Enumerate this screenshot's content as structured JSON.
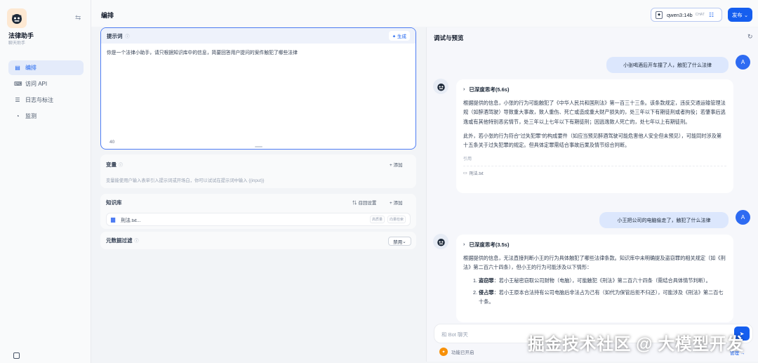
{
  "app": {
    "name": "法律助手",
    "type": "聊天助手"
  },
  "nav": {
    "items": [
      {
        "icon": "layout-icon",
        "label": "编排"
      },
      {
        "icon": "api-icon",
        "label": "访问 API"
      },
      {
        "icon": "log-icon",
        "label": "日志与标注"
      },
      {
        "icon": "monitor-icon",
        "label": "监测"
      }
    ]
  },
  "topbar": {
    "title": "编排",
    "model": "qwen3:14b",
    "model_mode": "CHAT",
    "publish": "发布"
  },
  "prompt": {
    "title": "提示词",
    "generate": "生成",
    "text": "你是一个法律小助手，请只根据知识库中的信息，简要回答用户提问的案件触犯了哪些法律",
    "count": "40"
  },
  "variables": {
    "title": "变量",
    "add": "添加",
    "desc": "变量能使用户输入表单引入提示词或开场白，你可以试试在提示词中输入 {{input}}"
  },
  "knowledge": {
    "title": "知识库",
    "recall": "召回设置",
    "add": "添加",
    "item": "刑法.txt...",
    "tags": [
      "高质量",
      "向量检索"
    ]
  },
  "metadata": {
    "title": "元数据过滤",
    "select": "禁用"
  },
  "preview": {
    "title": "调试与预览",
    "messages": [
      {
        "user": "小张喝酒后开车撞了人，触犯了什么法律",
        "avatar": "A",
        "thinking": "已深度思考(5.6s)",
        "p1": "根据提供的信息，小张的行为可能触犯了《中华人民共和国刑法》第一百三十三条。该条款规定，违反交通运输管理法规（如醉酒驾驶）导致重大事故，致人重伤、死亡或造成重大财产损失的，处三年以下有期徒刑或者拘役；若肇事后逃逸或有其他特别恶劣情节，处三年以上七年以下有期徒刑；因逃逸致人死亡的，处七年以上有期徒刑。",
        "p2": "此外，若小张的行为符合\"过失犯罪\"的构成要件（如应当预见醉酒驾驶可能危害他人安全但未预见），可能同时涉及第十五条关于过失犯罪的规定。但具体定罪需结合事故后果及情节综合判断。",
        "cite_label": "引用",
        "cite_file": "刑法.txt"
      },
      {
        "user": "小王把公司的电脑偷走了，触犯了什么法律",
        "avatar": "A",
        "thinking": "已深度思考(3.5s)",
        "p1": "根据提供的信息，无法直接判断小王的行为具体触犯了哪些法律条款。知识库中未明确提及盗窃罪的相关规定（如《刑法》第二百六十四条），但小王的行为可能涉及以下情形：",
        "steps": [
          {
            "term": "盗窃罪",
            "text": "：若小王秘密窃取公司财物（电脑），可能触犯《刑法》第二百六十四条（需结合具体情节判断）。"
          },
          {
            "term": "侵占罪",
            "text": "：若小王原本合法持有公司电脑后非法占为己有（如代为保管后拒不归还），可能涉及《刑法》第二百七十条。"
          }
        ]
      }
    ],
    "input_placeholder": "和 Bot 聊天",
    "feature": "功能已开启",
    "manage": "管理 →"
  },
  "watermark": "掘金技术社区 @ 大模型开发",
  "colors": {
    "accent": "#155eef",
    "user_bubble": "#dce7fd",
    "avatar": "#2e6bf2"
  }
}
